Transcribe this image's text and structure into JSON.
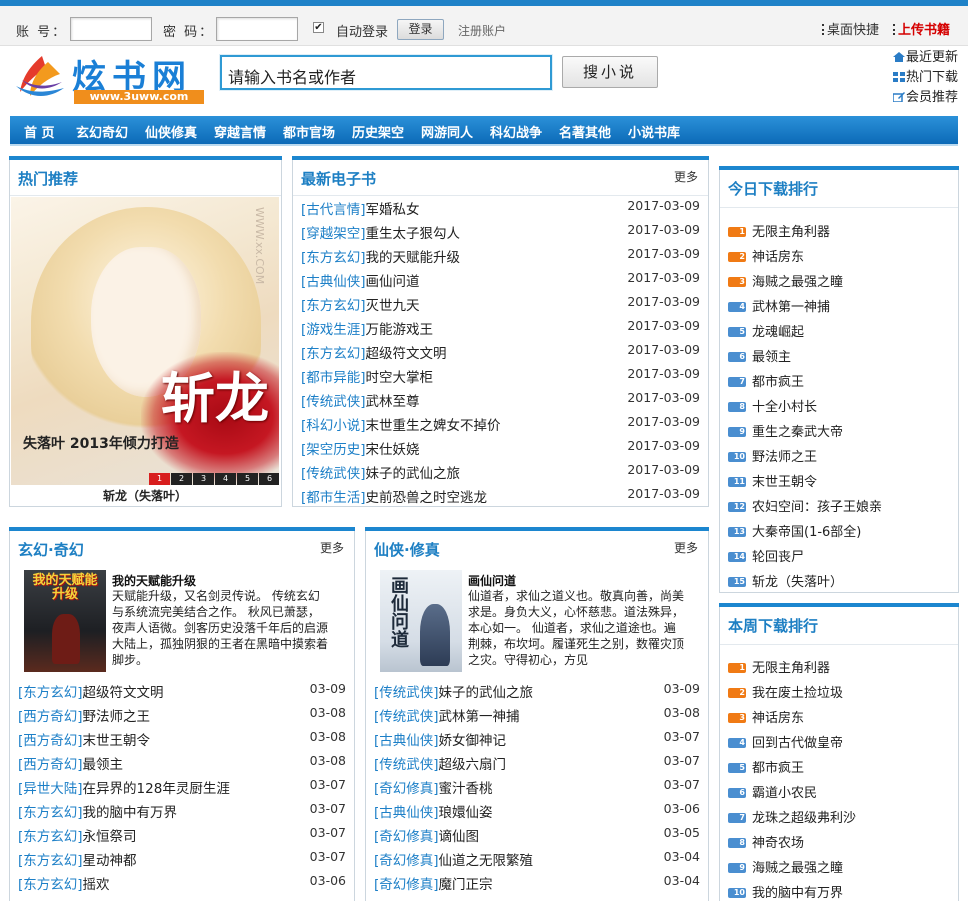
{
  "login": {
    "account_label": "账 号：",
    "password_label": "密 码：",
    "auto_login_label": "自动登录",
    "auto_login_checked_mark": "✔",
    "login_button": "登录",
    "register_link": "注册账户"
  },
  "quick": {
    "desktop_shortcut": "桌面快捷",
    "upload_book": "上传书籍"
  },
  "logo": {
    "name": "炫书网",
    "url": "www.3uww.com"
  },
  "search": {
    "value": "请输入书名或作者",
    "button": "搜小说"
  },
  "side_links": [
    "最近更新",
    "热门下载",
    "会员推荐"
  ],
  "nav": [
    "首 页",
    "玄幻奇幻",
    "仙侠修真",
    "穿越言情",
    "都市官场",
    "历史架空",
    "网游同人",
    "科幻战争",
    "名著其他",
    "小说书库"
  ],
  "hot": {
    "title": "热门推荐",
    "cover_title": "斩龙",
    "cover_author_line": "失落叶 2013年倾力打造",
    "watermark": "WWW.xx.COM",
    "pager": [
      "1",
      "2",
      "3",
      "4",
      "5",
      "6"
    ],
    "caption": "斩龙（失落叶）"
  },
  "latest": {
    "title": "最新电子书",
    "more": "更多",
    "items": [
      {
        "cat": "[古代言情]",
        "name": "军婚私女",
        "date": "2017-03-09"
      },
      {
        "cat": "[穿越架空]",
        "name": "重生太子狠勾人",
        "date": "2017-03-09"
      },
      {
        "cat": "[东方玄幻]",
        "name": "我的天赋能升级",
        "date": "2017-03-09"
      },
      {
        "cat": "[古典仙侠]",
        "name": "画仙问道",
        "date": "2017-03-09"
      },
      {
        "cat": "[东方玄幻]",
        "name": "灭世九天",
        "date": "2017-03-09"
      },
      {
        "cat": "[游戏生涯]",
        "name": "万能游戏王",
        "date": "2017-03-09"
      },
      {
        "cat": "[东方玄幻]",
        "name": "超级符文文明",
        "date": "2017-03-09"
      },
      {
        "cat": "[都市异能]",
        "name": "时空大掌柜",
        "date": "2017-03-09"
      },
      {
        "cat": "[传统武侠]",
        "name": "武林至尊",
        "date": "2017-03-09"
      },
      {
        "cat": "[科幻小说]",
        "name": "末世重生之婢女不掉价",
        "date": "2017-03-09"
      },
      {
        "cat": "[架空历史]",
        "name": "宋仕妖娆",
        "date": "2017-03-09"
      },
      {
        "cat": "[传统武侠]",
        "name": "妹子的武仙之旅",
        "date": "2017-03-09"
      },
      {
        "cat": "[都市生活]",
        "name": "史前恐兽之时空逃龙",
        "date": "2017-03-09"
      }
    ]
  },
  "xuanhuan": {
    "title": "玄幻·奇幻",
    "more": "更多",
    "feat_title": "我的天赋能升级",
    "feat_desc": "天赋能升级，又名剑灵传说。 传统玄幻与系统流完美结合之作。 秋风已萧瑟，夜声人语微。剑客历史没落千年后的启源大陆上，孤独阴狠的王者在黑暗中摸索着脚步。",
    "cover_text": "我的天赋能升级",
    "items": [
      {
        "cat": "[东方玄幻]",
        "name": "超级符文文明",
        "date": "03-09"
      },
      {
        "cat": "[西方奇幻]",
        "name": "野法师之王",
        "date": "03-08"
      },
      {
        "cat": "[西方奇幻]",
        "name": "末世王朝令",
        "date": "03-08"
      },
      {
        "cat": "[西方奇幻]",
        "name": "最领主",
        "date": "03-08"
      },
      {
        "cat": "[异世大陆]",
        "name": "在异界的128年灵厨生涯",
        "date": "03-07"
      },
      {
        "cat": "[东方玄幻]",
        "name": "我的脑中有万界",
        "date": "03-07"
      },
      {
        "cat": "[东方玄幻]",
        "name": "永恒祭司",
        "date": "03-07"
      },
      {
        "cat": "[东方玄幻]",
        "name": "星动神都",
        "date": "03-07"
      },
      {
        "cat": "[东方玄幻]",
        "name": "摇欢",
        "date": "03-06"
      }
    ]
  },
  "xianxia": {
    "title": "仙侠·修真",
    "more": "更多",
    "feat_title": "画仙问道",
    "feat_desc": "仙道者，求仙之道义也。敬真向善，尚美求是。身负大义，心怀慈悲。道法殊异，本心如一。 仙道者，求仙之道途也。遍荆棘，布坎坷。履谨死生之别，数罹灾顶之灾。守得初心，方见",
    "cover_text": "画仙问道",
    "items": [
      {
        "cat": "[传统武侠]",
        "name": "妹子的武仙之旅",
        "date": "03-09"
      },
      {
        "cat": "[传统武侠]",
        "name": "武林第一神捕",
        "date": "03-08"
      },
      {
        "cat": "[古典仙侠]",
        "name": "娇女御神记",
        "date": "03-07"
      },
      {
        "cat": "[传统武侠]",
        "name": "超级六扇门",
        "date": "03-07"
      },
      {
        "cat": "[奇幻修真]",
        "name": "蜜汁香桃",
        "date": "03-07"
      },
      {
        "cat": "[古典仙侠]",
        "name": "琅嬛仙姿",
        "date": "03-06"
      },
      {
        "cat": "[奇幻修真]",
        "name": "谪仙图",
        "date": "03-05"
      },
      {
        "cat": "[奇幻修真]",
        "name": "仙道之无限繁殖",
        "date": "03-04"
      },
      {
        "cat": "[奇幻修真]",
        "name": "魔门正宗",
        "date": "03-04"
      }
    ]
  },
  "today_rank": {
    "title": "今日下载排行",
    "items": [
      "无限主角利器",
      "神话房东",
      "海贼之最强之瞳",
      "武林第一神捕",
      "龙魂崛起",
      "最领主",
      "都市疯王",
      "十全小村长",
      "重生之秦武大帝",
      "野法师之王",
      "末世王朝令",
      "农妇空间：孩子王娘亲",
      "大秦帝国(1-6部全)",
      "轮回丧尸",
      "斩龙（失落叶）"
    ]
  },
  "week_rank": {
    "title": "本周下载排行",
    "items": [
      "无限主角利器",
      "我在废土捡垃圾",
      "神话房东",
      "回到古代做皇帝",
      "都市疯王",
      "霸道小农民",
      "龙珠之超级弗利沙",
      "神奇农场",
      "海贼之最强之瞳",
      "我的脑中有万界"
    ]
  },
  "colors": {
    "accent": "#1c86cf",
    "nav": "#1377c4",
    "rank_top": "#f07a14",
    "rank_other": "#4a8ed0",
    "upload": "#d50000"
  }
}
